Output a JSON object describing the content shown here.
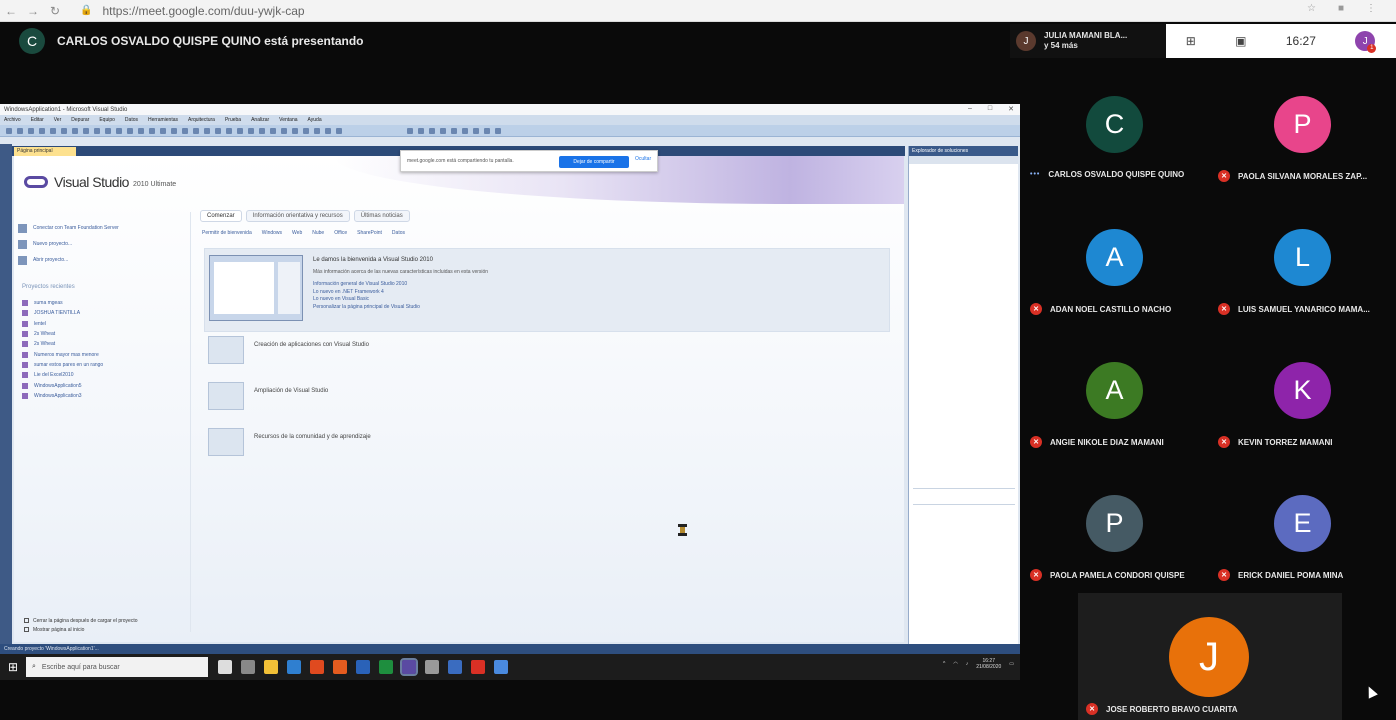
{
  "browser": {
    "url": "https://meet.google.com/duu-ywjk-cap"
  },
  "presenter": {
    "initial": "C",
    "text": "CARLOS OSVALDO QUISPE QUINO está presentando"
  },
  "meet_top": {
    "viewer_initial": "J",
    "viewer_line1": "JULIA MAMANI BLA...",
    "viewer_line2": "y 54 más",
    "time": "16:27",
    "me_initial": "J",
    "alert_count": "1"
  },
  "visual_studio": {
    "title": "WindowsApplication1 - Microsoft Visual Studio",
    "menu": [
      "Archivo",
      "Editar",
      "Ver",
      "Depurar",
      "Equipo",
      "Datos",
      "Herramientas",
      "Arquitectura",
      "Prueba",
      "Analizar",
      "Ventana",
      "Ayuda"
    ],
    "doc_tab": "Página principal",
    "logo_name": "Visual Studio",
    "logo_version": "2010 Ultimate",
    "share_dialog": {
      "text": "meet.google.com está compartiendo tu pantalla.",
      "stop_label": "Dejar de compartir",
      "hide_label": "Ocultar"
    },
    "left_links": [
      "Conectar con Team Foundation Server",
      "Nuevo proyecto...",
      "Abrir proyecto..."
    ],
    "recent_title": "Proyectos recientes",
    "recent_projects": [
      "suma mgeas",
      "JOSHUA TIENTILLA",
      "lentel",
      "2s Wheat",
      "2s Wheat",
      "Numeros mayor mas menore",
      "sumar estos pares en un rango",
      "Lie del Excel2010",
      "WindowsApplication5",
      "WindowsApplication3"
    ],
    "checks": [
      "Cerrar la página después de cargar el proyecto",
      "Mostrar página al inicio"
    ],
    "main_tabs": [
      "Comenzar",
      "Información orientativa y recursos",
      "Últimas noticias"
    ],
    "sub_tabs": [
      "Permitir de bienvenida",
      "Windows",
      "Web",
      "Nube",
      "Office",
      "SharePoint",
      "Datos"
    ],
    "welcome": {
      "title": "Le damos la bienvenida a Visual Studio 2010",
      "subtitle": "Más información acerca de las nuevas características incluidas en esta versión",
      "links": [
        "Información general de Visual Studio 2010",
        "Lo nuevo en .NET Framework 4",
        "Lo nuevo en Visual Basic",
        "Personalizar la página principal de Visual Studio"
      ]
    },
    "sections": [
      "Creación de aplicaciones con Visual Studio",
      "Ampliación de Visual Studio",
      "Recursos de la comunidad y de aprendizaje"
    ],
    "solution_title": "Explorador de soluciones",
    "status_text": "Creando proyecto 'WindowsApplication1'..."
  },
  "taskbar": {
    "search_placeholder": "Escribe aquí para buscar",
    "time": "16:27",
    "date": "21/08/2020"
  },
  "participants": [
    {
      "initial": "C",
      "name": "CARLOS OSVALDO QUISPE QUINO",
      "color": "#124a3d",
      "muted": false
    },
    {
      "initial": "P",
      "name": "PAOLA SILVANA MORALES ZAP...",
      "color": "#e8458b",
      "muted": true
    },
    {
      "initial": "A",
      "name": "ADAN NOEL CASTILLO NACHO",
      "color": "#1e88d2",
      "muted": true
    },
    {
      "initial": "L",
      "name": "LUIS SAMUEL YANARICO MAMA...",
      "color": "#1e88d2",
      "muted": true
    },
    {
      "initial": "A",
      "name": "ANGIE NIKOLE DIAZ MAMANI",
      "color": "#3c7a23",
      "muted": true
    },
    {
      "initial": "K",
      "name": "KEVIN TORREZ MAMANI",
      "color": "#8e24aa",
      "muted": true
    },
    {
      "initial": "P",
      "name": "PAOLA PAMELA CONDORI QUISPE",
      "color": "#455a64",
      "muted": true
    },
    {
      "initial": "E",
      "name": "ERICK DANIEL POMA MINA",
      "color": "#5c6bc0",
      "muted": true
    }
  ],
  "pip": {
    "initial": "J",
    "name": "JOSE ROBERTO BRAVO CUARITA",
    "color": "#e8710a"
  }
}
